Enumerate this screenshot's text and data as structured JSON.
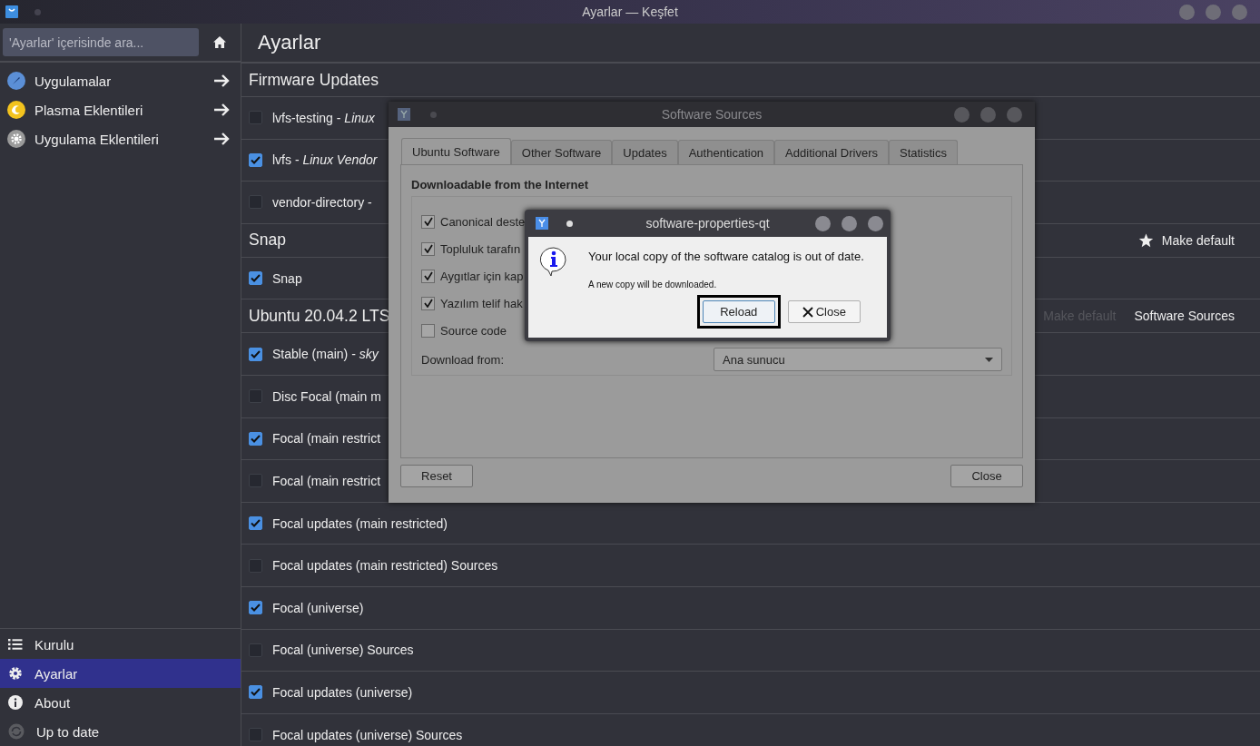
{
  "window": {
    "title": "Ayarlar — Keşfet"
  },
  "sidebar": {
    "search": {
      "placeholder": "'Ayarlar' içerisinde ara..."
    },
    "categories": [
      {
        "label": "Uygulamalar"
      },
      {
        "label": "Plasma Eklentileri"
      },
      {
        "label": "Uygulama Eklentileri"
      }
    ],
    "nav": [
      {
        "label": "Kurulu",
        "selected": false
      },
      {
        "label": "Ayarlar",
        "selected": true
      },
      {
        "label": "About",
        "selected": false
      },
      {
        "label": "Up to date",
        "selected": false
      }
    ]
  },
  "page": {
    "title": "Ayarlar",
    "sections": [
      {
        "title": "Firmware Updates",
        "sources": [
          {
            "label": "lvfs-testing - *Linux*",
            "checked": false
          },
          {
            "label": "lvfs - *Linux Vendor*",
            "checked": true
          },
          {
            "label": "vendor-directory -",
            "checked": false
          }
        ]
      },
      {
        "title": "Snap",
        "actions": [
          {
            "kind": "star",
            "label": "Make default",
            "disabled": false
          }
        ],
        "sources": [
          {
            "label": "Snap",
            "checked": true
          }
        ]
      },
      {
        "title": "Ubuntu 20.04.2 LTS",
        "actions": [
          {
            "kind": "plain",
            "label": "Make default",
            "disabled": true
          },
          {
            "kind": "plain",
            "label": "Software Sources",
            "disabled": false
          }
        ],
        "sources": [
          {
            "label": "Stable (main) - *sky*",
            "checked": true
          },
          {
            "label": "Disc Focal (main m",
            "checked": false
          },
          {
            "label": "Focal (main restrict",
            "checked": true
          },
          {
            "label": "Focal (main restrict",
            "checked": false
          },
          {
            "label": "Focal updates (main restricted)",
            "checked": true
          },
          {
            "label": "Focal updates (main restricted) Sources",
            "checked": false
          },
          {
            "label": "Focal (universe)",
            "checked": true
          },
          {
            "label": "Focal (universe) Sources",
            "checked": false
          },
          {
            "label": "Focal updates (universe)",
            "checked": true
          },
          {
            "label": "Focal updates (universe) Sources",
            "checked": false
          }
        ]
      }
    ]
  },
  "dialog": {
    "title": "Software Sources",
    "tabs": [
      {
        "label": "Ubuntu Software",
        "selected": true
      },
      {
        "label": "Other Software",
        "selected": false
      },
      {
        "label": "Updates",
        "selected": false
      },
      {
        "label": "Authentication",
        "selected": false
      },
      {
        "label": "Additional Drivers",
        "selected": false
      },
      {
        "label": "Statistics",
        "selected": false
      }
    ],
    "group_title": "Downloadable from the Internet",
    "options": [
      {
        "label": "Canonical deste",
        "checked": true
      },
      {
        "label": "Topluluk tarafın",
        "checked": true
      },
      {
        "label": "Aygıtlar için kap",
        "checked": true
      },
      {
        "label": "Yazılım telif hak",
        "checked": true
      },
      {
        "label": "Source code",
        "checked": false
      }
    ],
    "download_from": {
      "label": "Download from:",
      "value": "Ana sunucu"
    },
    "buttons": [
      "Reset",
      "Close"
    ]
  },
  "message": {
    "title": "software-properties-qt",
    "text": "Your local copy of the software catalog is out of date.",
    "detail": "A new copy will be downloaded.",
    "buttons": [
      {
        "kind": "plain",
        "label": "Reload",
        "focused": true
      },
      {
        "kind": "close",
        "label": "Close",
        "focused": false
      }
    ]
  }
}
